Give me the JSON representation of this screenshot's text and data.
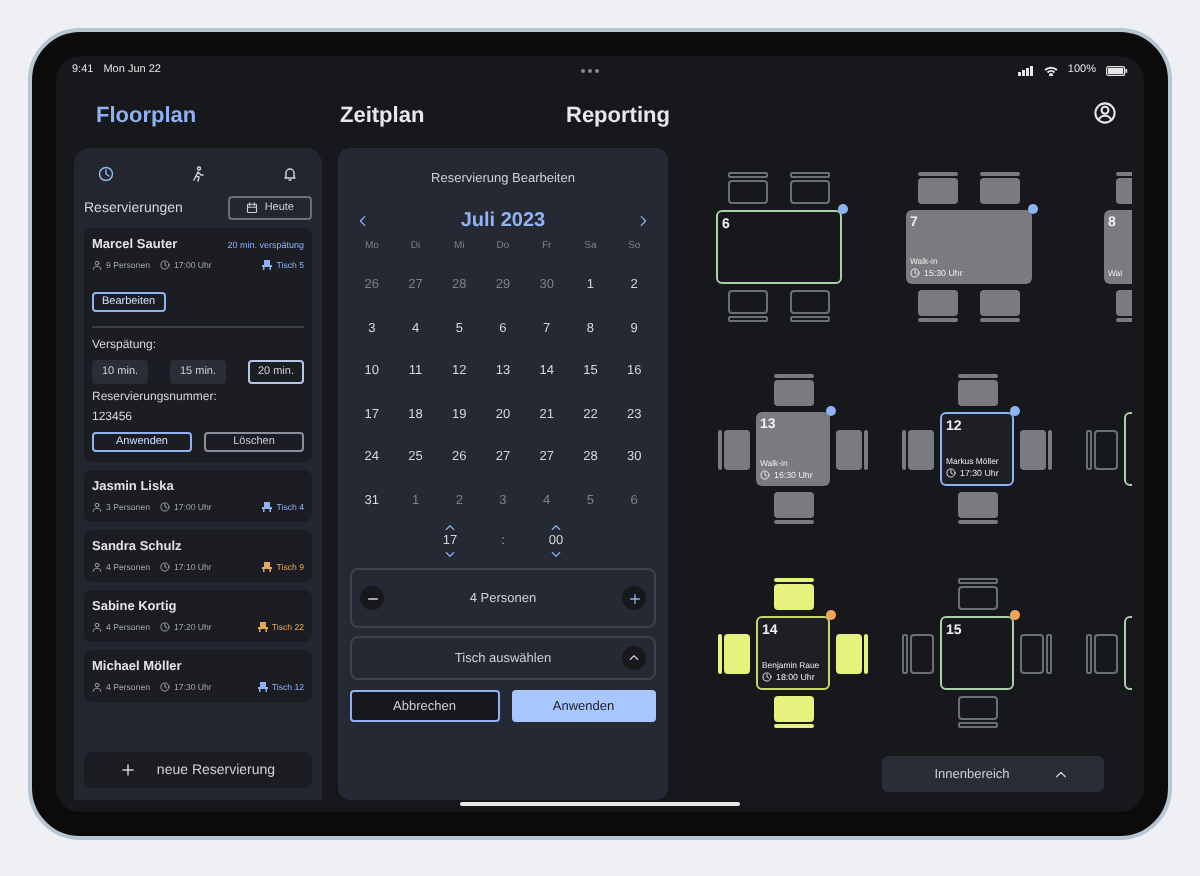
{
  "status_bar": {
    "time": "9:41",
    "date": "Mon Jun 22",
    "battery": "100%"
  },
  "nav": {
    "tabs": [
      {
        "label": "Floorplan",
        "selected": true
      },
      {
        "label": "Zeitplan",
        "selected": false
      },
      {
        "label": "Reporting",
        "selected": false
      }
    ]
  },
  "sidebar": {
    "tabs": [
      {
        "kind": "clock",
        "selected": true
      },
      {
        "kind": "walk",
        "selected": false
      },
      {
        "kind": "bell",
        "selected": false
      }
    ],
    "title": "Reservierungen",
    "today_button": "Heute",
    "reservations": [
      {
        "name": "Marcel Sauter",
        "delay": "20 min. verspätung",
        "guests": "9 Personen",
        "time": "17:00 Uhr",
        "table": "Tisch 5",
        "color": "#8fb2f2",
        "details": {
          "edit_button": "Bearbeiten",
          "delay_label": "Verspätung:",
          "delay_options": [
            {
              "label": "10 min.",
              "selected": false
            },
            {
              "label": "15 min.",
              "selected": false
            },
            {
              "label": "20 min.",
              "selected": true
            }
          ],
          "number_label": "Reservierungsnummer:",
          "number": "123456",
          "apply_button": "Anwenden",
          "delete_button": "Löschen"
        }
      },
      {
        "name": "Jasmin Liska",
        "guests": "3 Personen",
        "time": "17:00 Uhr",
        "table": "Tisch 4",
        "color": "#8fb2f2"
      },
      {
        "name": "Sandra Schulz",
        "guests": "4 Personen",
        "time": "17:10 Uhr",
        "table": "Tisch 9",
        "color": "#e7a85a"
      },
      {
        "name": "Sabine Kortig",
        "guests": "4 Personen",
        "time": "17:20 Uhr",
        "table": "Tisch 22",
        "color": "#e7a85a"
      },
      {
        "name": "Michael Möller",
        "guests": "4 Personen",
        "time": "17:30 Uhr",
        "table": "Tisch 12",
        "color": "#8fb2f2"
      }
    ],
    "new_button": "neue Reservierung"
  },
  "editor": {
    "title": "Reservierung Bearbeiten",
    "month": "Juli 2023",
    "weekdays": [
      "Mo",
      "Di",
      "Mi",
      "Do",
      "Fr",
      "Sa",
      "So"
    ],
    "weeks": [
      [
        {
          "label": "26",
          "outside": true
        },
        {
          "label": "27",
          "outside": true
        },
        {
          "label": "28",
          "outside": true
        },
        {
          "label": "29",
          "outside": true
        },
        {
          "label": "30",
          "outside": true
        },
        {
          "label": "1",
          "outside": false
        },
        {
          "label": "2",
          "outside": false
        }
      ],
      [
        {
          "label": "3",
          "outside": false
        },
        {
          "label": "4",
          "outside": false
        },
        {
          "label": "5",
          "outside": false
        },
        {
          "label": "6",
          "outside": false
        },
        {
          "label": "7",
          "outside": false
        },
        {
          "label": "8",
          "outside": false
        },
        {
          "label": "9",
          "outside": false
        }
      ],
      [
        {
          "label": "10",
          "outside": false
        },
        {
          "label": "11",
          "outside": false
        },
        {
          "label": "12",
          "outside": false
        },
        {
          "label": "13",
          "outside": false
        },
        {
          "label": "14",
          "outside": false
        },
        {
          "label": "15",
          "outside": false
        },
        {
          "label": "16",
          "outside": false
        }
      ],
      [
        {
          "label": "17",
          "outside": false
        },
        {
          "label": "18",
          "outside": false
        },
        {
          "label": "19",
          "outside": false
        },
        {
          "label": "20",
          "outside": false
        },
        {
          "label": "21",
          "outside": false
        },
        {
          "label": "22",
          "outside": false
        },
        {
          "label": "23",
          "outside": false
        }
      ],
      [
        {
          "label": "24",
          "outside": false
        },
        {
          "label": "25",
          "outside": false
        },
        {
          "label": "26",
          "outside": false
        },
        {
          "label": "27",
          "outside": false
        },
        {
          "label": "27",
          "outside": false
        },
        {
          "label": "28",
          "outside": false
        },
        {
          "label": "30",
          "outside": false
        }
      ],
      [
        {
          "label": "31",
          "outside": false
        },
        {
          "label": "1",
          "outside": true
        },
        {
          "label": "2",
          "outside": true
        },
        {
          "label": "3",
          "outside": true
        },
        {
          "label": "4",
          "outside": true
        },
        {
          "label": "5",
          "outside": true
        },
        {
          "label": "6",
          "outside": true
        }
      ]
    ],
    "hour": "17",
    "separator": ":",
    "minute": "00",
    "persons": "4 Personen",
    "table_select": "Tisch auswählen",
    "cancel_button": "Abbrechen",
    "apply_button": "Anwenden"
  },
  "floor": {
    "tables": [
      {
        "kind": "free",
        "number": "6",
        "color": "#8fb2f2"
      },
      {
        "kind": "occupied",
        "number": "7",
        "guest": "Walk-in",
        "time": "15:30 Uhr",
        "color": "#8fb2f2"
      },
      {
        "kind": "occupied",
        "number": "8",
        "guest": "Wal"
      },
      {
        "kind": "occupied",
        "number": "13",
        "guest": "Walk-in",
        "time": "16:30 Uhr",
        "color": "#8fb2f2"
      },
      {
        "kind": "selected",
        "number": "12",
        "guest": "Markus Möller",
        "time": "17:30 Uhr",
        "color": "#8fb2f2"
      },
      {
        "kind": "free"
      },
      {
        "kind": "highlighted",
        "number": "14",
        "guest": "Benjamin Raue",
        "time": "18:00 Uhr",
        "color": "#f0a55a"
      },
      {
        "kind": "free",
        "number": "15",
        "color": "#f0a55a"
      },
      {
        "kind": "free"
      }
    ],
    "area_select": "Innenbereich"
  }
}
